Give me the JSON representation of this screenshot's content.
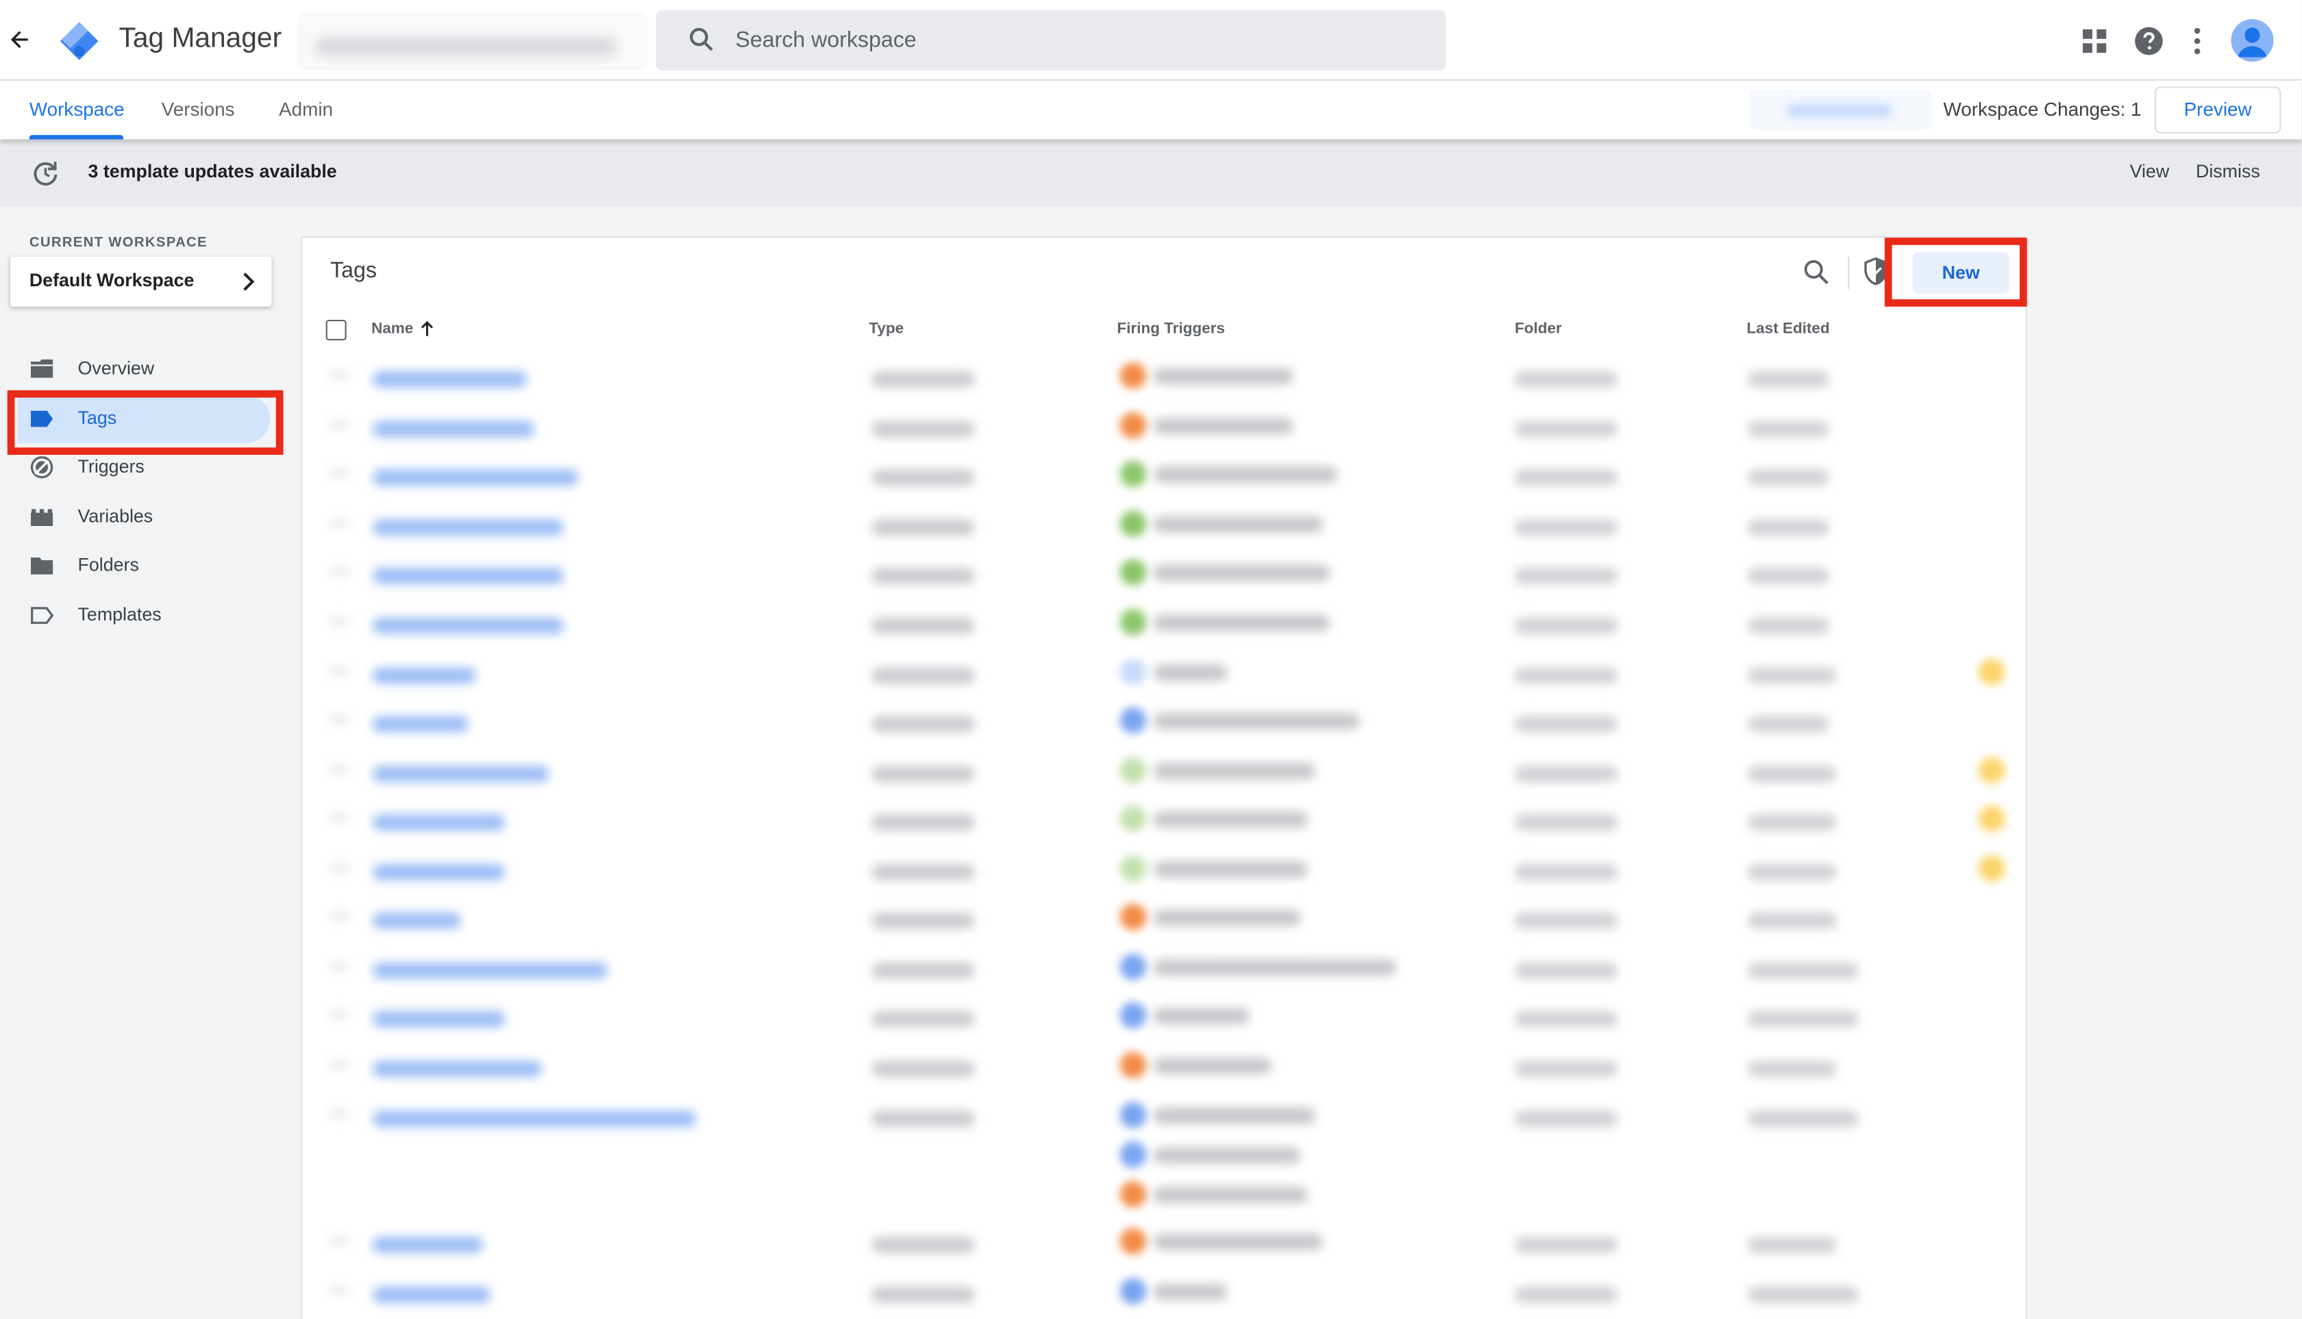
{
  "header": {
    "app_title": "Tag Manager",
    "search_placeholder": "Search workspace"
  },
  "nav": {
    "tabs": [
      {
        "label": "Workspace",
        "active": true
      },
      {
        "label": "Versions",
        "active": false
      },
      {
        "label": "Admin",
        "active": false
      }
    ],
    "workspace_changes": "Workspace Changes: 1",
    "preview_label": "Preview"
  },
  "banner": {
    "message": "3 template updates available",
    "view_label": "View",
    "dismiss_label": "Dismiss"
  },
  "sidebar": {
    "current_workspace_label": "CURRENT WORKSPACE",
    "workspace_name": "Default Workspace",
    "items": [
      {
        "label": "Overview",
        "icon": "overview-icon"
      },
      {
        "label": "Tags",
        "icon": "tag-icon",
        "active": true
      },
      {
        "label": "Triggers",
        "icon": "trigger-icon"
      },
      {
        "label": "Variables",
        "icon": "variables-icon"
      },
      {
        "label": "Folders",
        "icon": "folder-icon"
      },
      {
        "label": "Templates",
        "icon": "template-icon"
      }
    ]
  },
  "tags_panel": {
    "title": "Tags",
    "new_label": "New",
    "columns": {
      "name": "Name",
      "type": "Type",
      "firing_triggers": "Firing Triggers",
      "folder": "Folder",
      "last_edited": "Last Edited"
    }
  },
  "colors": {
    "accent": "#1a73e8",
    "highlight": "#ea2a18",
    "trigger_orange": "#f28b46",
    "trigger_green": "#8cc66a",
    "trigger_blue": "#7aa5f0",
    "notice_yellow": "#fbd46b"
  }
}
